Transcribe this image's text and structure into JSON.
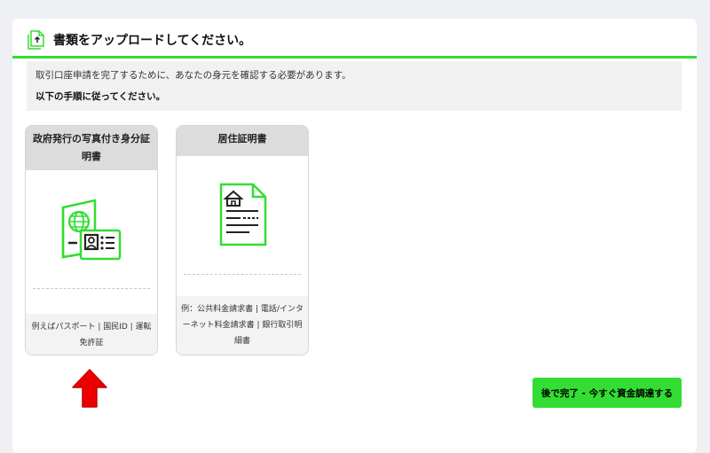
{
  "header": {
    "title": "書類をアップロードしてください。",
    "icon": "upload-file-icon"
  },
  "notice": {
    "line1": "取引口座申請を完了するために、あなたの身元を確認する必要があります。",
    "line2": "以下の手順に従ってください。"
  },
  "documents": [
    {
      "title": "政府発行の写真付き身分証明書",
      "example": "例えばパスポート | 国民ID | 運転免許証",
      "icon": "passport-id-card-icon"
    },
    {
      "title": "居住証明書",
      "example": "例：公共料金請求書 | 電話/インターネット料金請求書 | 銀行取引明細書",
      "icon": "residence-document-icon"
    }
  ],
  "later_button": {
    "label": "後で完了 - 今すぐ資金調達する"
  },
  "colors": {
    "accent": "#33dd33",
    "arrow": "#ee0000"
  }
}
